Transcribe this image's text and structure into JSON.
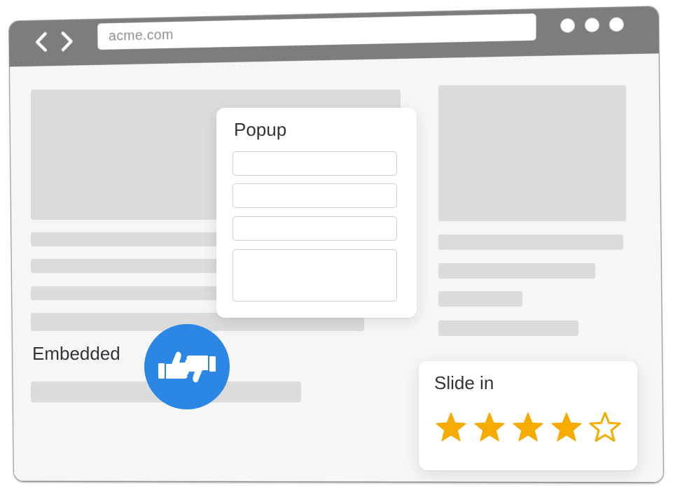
{
  "browser": {
    "url": "acme.com",
    "nav": {
      "back_icon": "chevron-left-icon",
      "forward_icon": "chevron-right-icon"
    },
    "window_dots": 3,
    "chrome_color": "#7d7d7d"
  },
  "popup": {
    "title": "Popup",
    "fields": [
      "",
      "",
      ""
    ],
    "textarea": ""
  },
  "embedded": {
    "label": "Embedded",
    "widget_icon": "thumbs-up-down-icon",
    "widget_color": "#2b87e3"
  },
  "slide_in": {
    "title": "Slide in",
    "rating": 4,
    "max_rating": 5,
    "star_color": "#f5ab00"
  }
}
